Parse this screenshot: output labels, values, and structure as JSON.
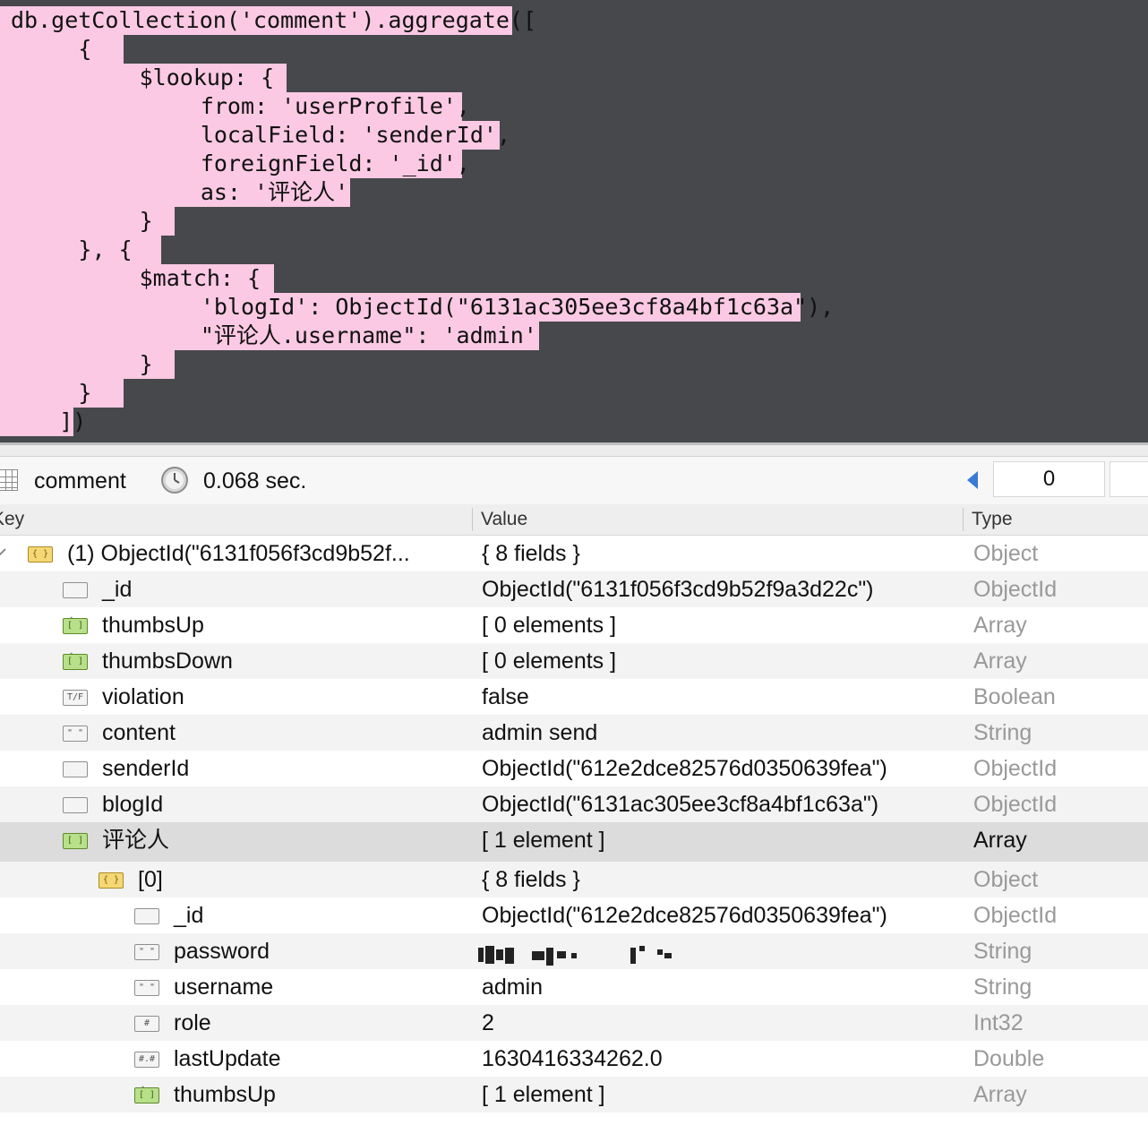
{
  "query": {
    "lines": [
      "db.getCollection('comment').aggregate([",
      "        {",
      "            $lookup: {",
      "                from: 'userProfile',",
      "                localField: 'senderId',",
      "                foreignField: '_id',",
      "                as: '评论人'",
      "            }",
      "        }, {",
      "            $match: {",
      "                'blogId': ObjectId(\"6131ac305ee3cf8a4bf1c63a\"),",
      "                \"评论人.username\": 'admin'",
      "            }",
      "        }",
      "    ])"
    ]
  },
  "toolbar": {
    "collection": "comment",
    "elapsed": "0.068 sec.",
    "page_value": "0"
  },
  "columns": {
    "key": "Key",
    "value": "Value",
    "type": "Type"
  },
  "rows": [
    {
      "key": "(1) ObjectId(\"6131f056f3cd9b52f...",
      "value": "{ 8 fields }",
      "type": "Object",
      "icon": "object-icon",
      "level": 0,
      "expander": "expanded"
    },
    {
      "key": "_id",
      "value": "ObjectId(\"6131f056f3cd9b52f9a3d22c\")",
      "type": "ObjectId",
      "icon": "objectid-icon",
      "level": 1,
      "expander": "none"
    },
    {
      "key": "thumbsUp",
      "value": "[ 0 elements ]",
      "type": "Array",
      "icon": "array-icon",
      "level": 1,
      "expander": "collapsed"
    },
    {
      "key": "thumbsDown",
      "value": "[ 0 elements ]",
      "type": "Array",
      "icon": "array-icon",
      "level": 1,
      "expander": "collapsed"
    },
    {
      "key": "violation",
      "value": "false",
      "type": "Boolean",
      "icon": "boolean-icon",
      "level": 1,
      "expander": "none"
    },
    {
      "key": "content",
      "value": "admin send",
      "type": "String",
      "icon": "string-icon",
      "level": 1,
      "expander": "none"
    },
    {
      "key": "senderId",
      "value": "ObjectId(\"612e2dce82576d0350639fea\")",
      "type": "ObjectId",
      "icon": "objectid-icon",
      "level": 1,
      "expander": "none"
    },
    {
      "key": "blogId",
      "value": "ObjectId(\"6131ac305ee3cf8a4bf1c63a\")",
      "type": "ObjectId",
      "icon": "objectid-icon",
      "level": 1,
      "expander": "none"
    },
    {
      "key": "评论人",
      "value": "[ 1 element ]",
      "type": "Array",
      "icon": "array-icon",
      "level": 1,
      "expander": "expanded"
    },
    {
      "key": "[0]",
      "value": "{ 8 fields }",
      "type": "Object",
      "icon": "object-icon",
      "level": 2,
      "expander": "expanded"
    },
    {
      "key": "_id",
      "value": "ObjectId(\"612e2dce82576d0350639fea\")",
      "type": "ObjectId",
      "icon": "objectid-icon",
      "level": 3,
      "expander": "none"
    },
    {
      "key": "password",
      "value": "",
      "type": "String",
      "icon": "string-icon",
      "level": 3,
      "expander": "none"
    },
    {
      "key": "username",
      "value": "admin",
      "type": "String",
      "icon": "string-icon",
      "level": 3,
      "expander": "none"
    },
    {
      "key": "role",
      "value": "2",
      "type": "Int32",
      "icon": "int32-icon",
      "level": 3,
      "expander": "none"
    },
    {
      "key": "lastUpdate",
      "value": "1630416334262.0",
      "type": "Double",
      "icon": "double-icon",
      "level": 3,
      "expander": "none"
    },
    {
      "key": "thumbsUp",
      "value": "[ 1 element ]",
      "type": "Array",
      "icon": "array-icon",
      "level": 3,
      "expander": "collapsed"
    }
  ],
  "colors": {
    "highlight": "#fbc9e3",
    "editor_bg": "#46484b",
    "selected_row": "#dcdcdc"
  }
}
